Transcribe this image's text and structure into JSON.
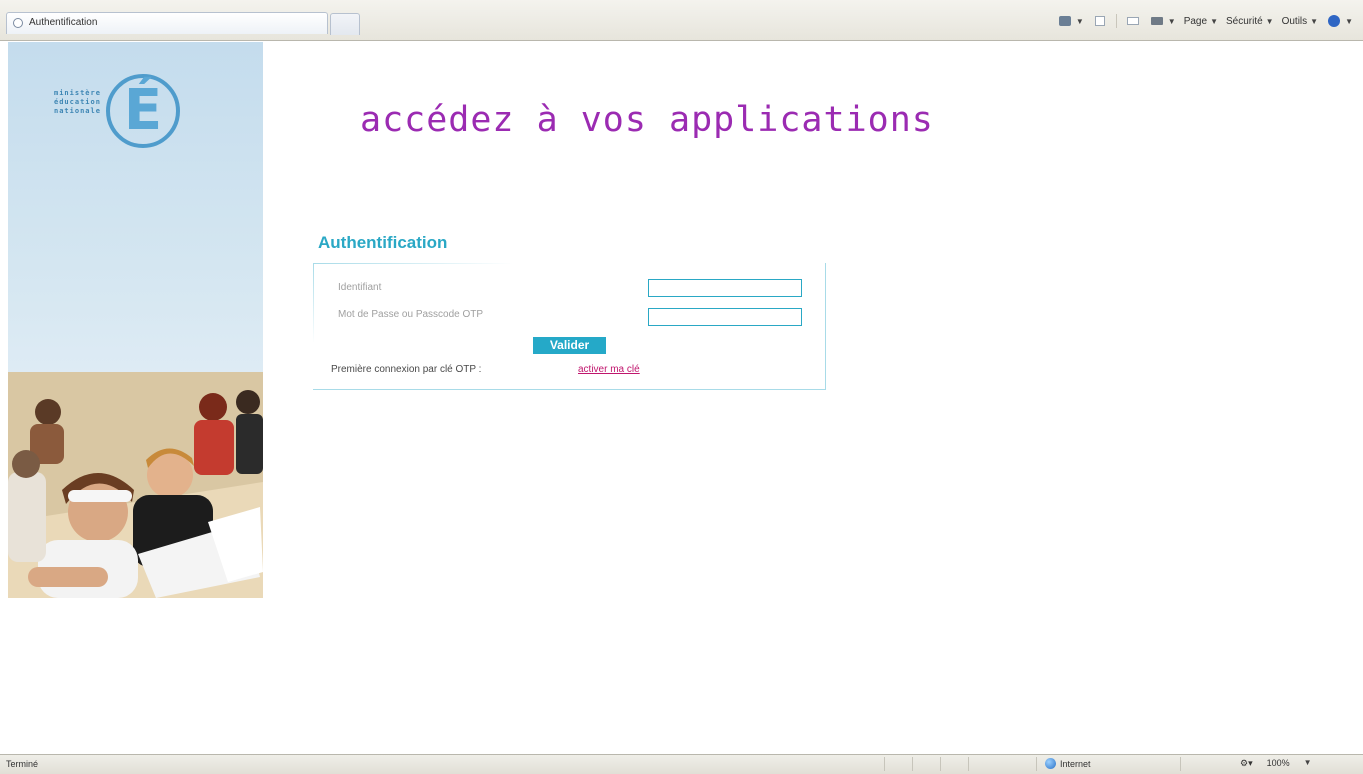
{
  "browser": {
    "tab_title": "Authentification",
    "tools": {
      "page_label": "Page",
      "security_label": "Sécurité",
      "tools_label": "Outils"
    }
  },
  "banner": {
    "logo_text": "ministère éducation nationale"
  },
  "main": {
    "hero_title": "accédez à vos applications",
    "auth_title": "Authentification",
    "id_label": "Identifiant",
    "password_label": "Mot de Passe ou Passcode OTP",
    "id_value": "",
    "password_value": "",
    "submit_label": "Valider",
    "otp_text": "Première connexion par clé OTP :",
    "otp_link": "activer ma clé"
  },
  "status": {
    "left_text": "Terminé",
    "zone_text": "Internet",
    "zoom_text": "100%"
  },
  "colors": {
    "accent": "#25a9c8",
    "hero": "#9b2bb2",
    "link": "#c0156d"
  }
}
